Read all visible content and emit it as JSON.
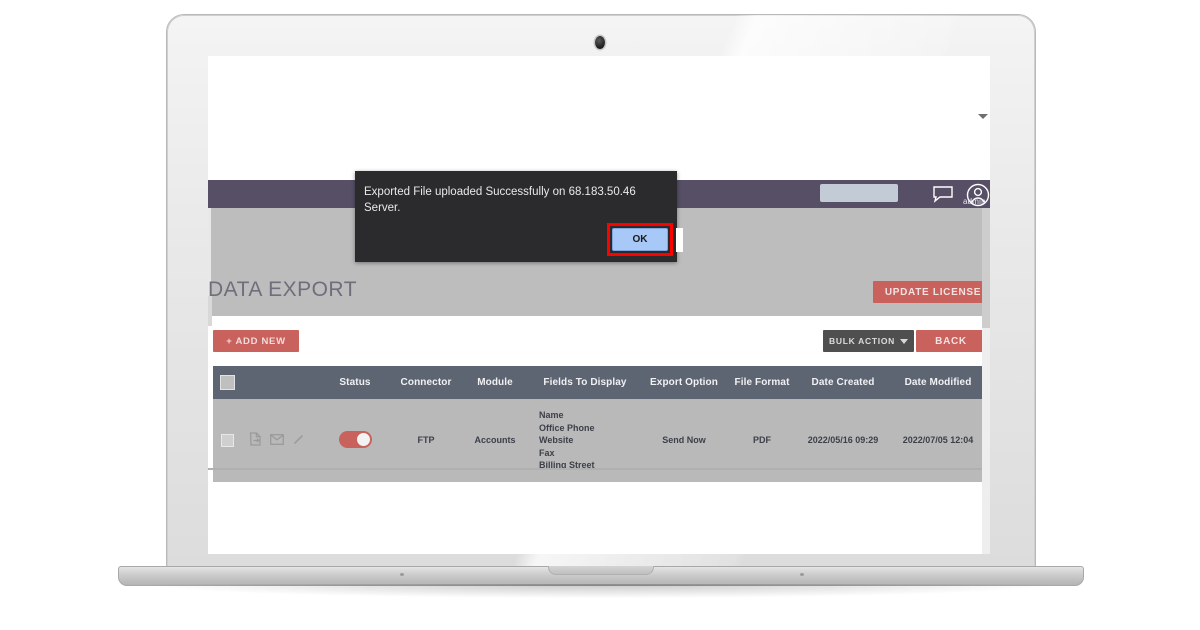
{
  "device": {
    "kind": "laptop-mockup",
    "camera": "camera-dot"
  },
  "navbar": {
    "chat_icon": "chat-bubble-icon",
    "avatar_icon": "user-avatar-icon",
    "user_label": "admin"
  },
  "page": {
    "title": "DATA EXPORT",
    "add_new_label": "+ ADD NEW",
    "update_license_label": "UPDATE LICENSE",
    "bulk_action_label": "BULK ACTION",
    "back_label": "BACK",
    "dropdown_caret_icon": "chevron-down-icon"
  },
  "table": {
    "columns": [
      "",
      "",
      "Status",
      "Connector",
      "Module",
      "Fields To Display",
      "Export Option",
      "File Format",
      "Date Created",
      "Date Modified"
    ],
    "row_icons": [
      "export-file-icon",
      "envelope-icon",
      "pencil-edit-icon"
    ],
    "rows": [
      {
        "selected": false,
        "status_on": true,
        "connector": "FTP",
        "module": "Accounts",
        "fields_to_display": [
          "Name",
          "Office Phone",
          "Website",
          "Fax",
          "Billing Street"
        ],
        "export_option": "Send Now",
        "file_format": "PDF",
        "date_created": "2022/05/16 09:29",
        "date_modified": "2022/07/05 12:04"
      }
    ]
  },
  "dialog": {
    "message": "Exported File uploaded Successfully on 68.183.50.46 Server.",
    "ok_label": "OK",
    "highlight_color": "#ff0000",
    "ok_button_color": "#a8c8f8",
    "background_color": "#2b2b2e"
  },
  "colors": {
    "navbar": "#564f66",
    "accent_red": "#c9615c",
    "table_header": "#5d6472",
    "content_bg": "#bdbdbd",
    "row_bg": "#b9b9b9"
  }
}
